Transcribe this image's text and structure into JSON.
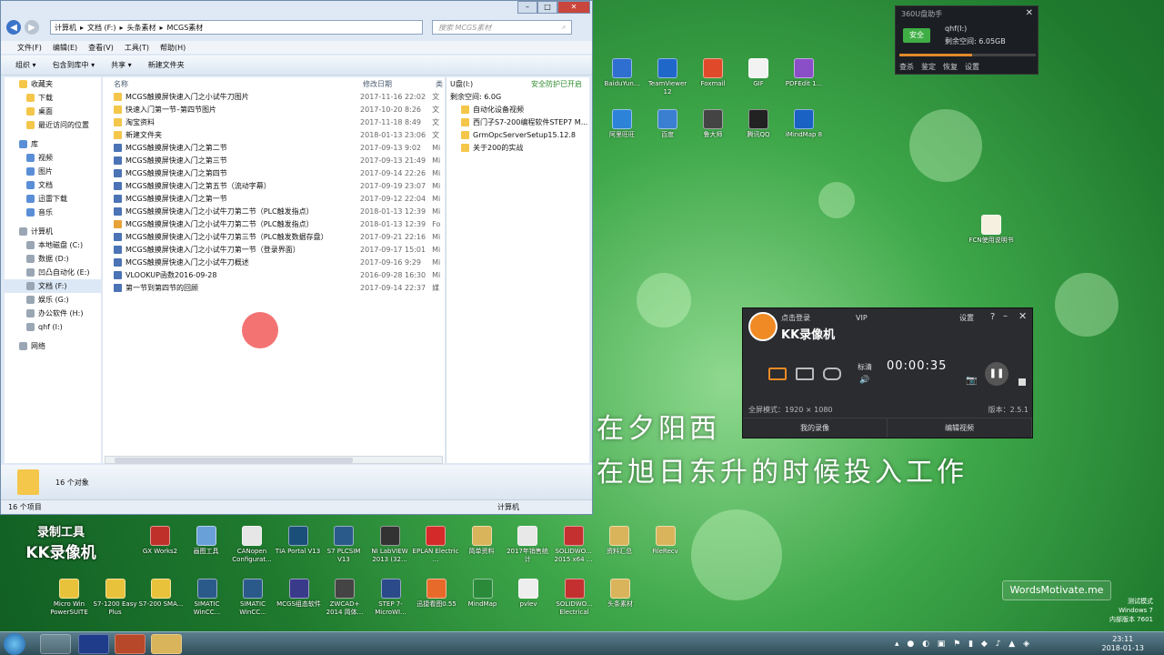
{
  "explorer": {
    "breadcrumb": [
      "计算机",
      "文档 (F:)",
      "头条素材",
      "MCGS素材"
    ],
    "search_placeholder": "搜索 MCGS素材",
    "menu": [
      "文件(F)",
      "编辑(E)",
      "查看(V)",
      "工具(T)",
      "帮助(H)"
    ],
    "toolbar": [
      "组织 ▾",
      "包含到库中 ▾",
      "共享 ▾",
      "新建文件夹"
    ],
    "nav": [
      {
        "label": "收藏夹",
        "sub": false
      },
      {
        "label": "下载",
        "sub": true
      },
      {
        "label": "桌面",
        "sub": true
      },
      {
        "label": "最近访问的位置",
        "sub": true
      },
      {
        "label": "库",
        "sub": false
      },
      {
        "label": "视频",
        "sub": true
      },
      {
        "label": "图片",
        "sub": true
      },
      {
        "label": "文档",
        "sub": true
      },
      {
        "label": "迅雷下载",
        "sub": true
      },
      {
        "label": "音乐",
        "sub": true
      },
      {
        "label": "计算机",
        "sub": false
      },
      {
        "label": "本地磁盘 (C:)",
        "sub": true
      },
      {
        "label": "数据 (D:)",
        "sub": true
      },
      {
        "label": "凹凸自动化 (E:)",
        "sub": true
      },
      {
        "label": "文档 (F:)",
        "sub": true
      },
      {
        "label": "娱乐 (G:)",
        "sub": true
      },
      {
        "label": "办公软件 (H:)",
        "sub": true
      },
      {
        "label": "qhf (I:)",
        "sub": true
      },
      {
        "label": "网络",
        "sub": false
      }
    ],
    "columns": [
      "名称",
      "修改日期",
      "类"
    ],
    "files": [
      {
        "name": "MCGS触摸屏快速入门之小试牛刀图片",
        "date": "2017-11-16 22:02",
        "type": "文",
        "icon": "folder"
      },
      {
        "name": "快速入门第一节–第四节图片",
        "date": "2017-10-20 8:26",
        "type": "文",
        "icon": "folder"
      },
      {
        "name": "淘宝资料",
        "date": "2017-11-18 8:49",
        "type": "文",
        "icon": "folder"
      },
      {
        "name": "新建文件夹",
        "date": "2018-01-13 23:06",
        "type": "文",
        "icon": "folder"
      },
      {
        "name": "MCGS触摸屏快速入门之第二节",
        "date": "2017-09-13 9:02",
        "type": "Mi",
        "icon": "doc"
      },
      {
        "name": "MCGS触摸屏快速入门之第三节",
        "date": "2017-09-13 21:49",
        "type": "Mi",
        "icon": "doc"
      },
      {
        "name": "MCGS触摸屏快速入门之第四节",
        "date": "2017-09-14 22:26",
        "type": "Mi",
        "icon": "doc"
      },
      {
        "name": "MCGS触摸屏快速入门之第五节（流动字幕）",
        "date": "2017-09-19 23:07",
        "type": "Mi",
        "icon": "doc"
      },
      {
        "name": "MCGS触摸屏快速入门之第一节",
        "date": "2017-09-12 22:04",
        "type": "Mi",
        "icon": "doc"
      },
      {
        "name": "MCGS触摸屏快速入门之小试牛刀第二节（PLC触发指点）",
        "date": "2018-01-13 12:39",
        "type": "Mi",
        "icon": "doc"
      },
      {
        "name": "MCGS触摸屏快速入门之小试牛刀第二节（PLC触发指点）",
        "date": "2018-01-13 12:39",
        "type": "Fo",
        "icon": "pdf"
      },
      {
        "name": "MCGS触摸屏快速入门之小试牛刀第三节（PLC触发数据存盘）",
        "date": "2017-09-21 22:16",
        "type": "Mi",
        "icon": "doc"
      },
      {
        "name": "MCGS触摸屏快速入门之小试牛刀第一节（登录界面）",
        "date": "2017-09-17 15:01",
        "type": "Mi",
        "icon": "doc"
      },
      {
        "name": "MCGS触摸屏快速入门之小试牛刀概述",
        "date": "2017-09-16 9:29",
        "type": "Mi",
        "icon": "doc"
      },
      {
        "name": "VLOOKUP函数2016-09-28",
        "date": "2016-09-28 16:30",
        "type": "Mi",
        "icon": "doc"
      },
      {
        "name": "第一节到第四节的回顾",
        "date": "2017-09-14 22:37",
        "type": "媒",
        "icon": "doc"
      }
    ],
    "preview": {
      "drive": "U盘(I:)",
      "autoplay": "安全防护已开启",
      "free": "剩余空间: 6.0G",
      "items": [
        "自动化设备视频",
        "西门子S7-200编程软件STEP7 M...",
        "GrmOpcServerSetup15.12.8",
        "关于200的实战"
      ]
    },
    "count_label": "16 个对象",
    "status_left": "16 个项目",
    "status_right": "计算机"
  },
  "w360": {
    "title": "360U盘助手",
    "safe": "安全",
    "drive": "qhf(I:)",
    "free": "剩余空间: 6.05GB",
    "actions": [
      "查杀",
      "鉴定",
      "恢复",
      "设置"
    ]
  },
  "desktop_right": [
    {
      "label": "BaiduYun...",
      "x": 0
    },
    {
      "label": "TeamViewer 12",
      "x": 1
    },
    {
      "label": "Foxmail",
      "x": 2
    },
    {
      "label": "GIF",
      "x": 3
    },
    {
      "label": "PDFEdit 1...",
      "x": 4
    },
    {
      "label": "阿里旺旺",
      "x": 0
    },
    {
      "label": "百度",
      "x": 1
    },
    {
      "label": "鲁大师",
      "x": 2
    },
    {
      "label": "腾讯QQ",
      "x": 3
    },
    {
      "label": "iMindMap 8",
      "x": 4
    }
  ],
  "fcn_icon": "FCN使用说明书",
  "kk": {
    "login": "点击登录",
    "vip": "VIP",
    "title": "KK录像机",
    "settings": "设置",
    "help": "?",
    "quality": "标清",
    "time": "00:00:35",
    "fullscreen": "全屏模式：1920 × 1080",
    "version": "版本：2.5.1",
    "my_video": "我的录像",
    "edit_video": "编辑视频"
  },
  "subtitle1": "在夕阳西",
  "subtitle2": "在旭日东升的时候投入工作",
  "watermark": "WordsMotivate.me",
  "win7": [
    "测试模式",
    "Windows 7",
    "内部版本 7601"
  ],
  "kk_logo": [
    "录制工具",
    "KK录像机"
  ],
  "desktop_bottom1": [
    "GX Works2",
    "画图工具",
    "CANopen Configurat...",
    "TIA Portal V13",
    "S7 PLCSIM V13",
    "NI LabVIEW 2013 (32...",
    "EPLAN Electric ...",
    "简单资料",
    "2017年销售统计",
    "SOLIDWO... 2015 x64 ...",
    "资料汇总",
    "FileRecv"
  ],
  "desktop_bottom2": [
    "Micro Win PowerSUITE",
    "S7-1200 Easy Plus",
    "S7-200 SMA...",
    "SIMATIC WinCC...",
    "SIMATIC WinCC...",
    "MCGS组态软件",
    "ZWCAD+ 2014 简体...",
    "STEP 7-MicroWI...",
    "迅捷看图0.55",
    "MindMap",
    "pvlev",
    "SOLIDWO... Electrical",
    "头条素材"
  ],
  "clock": {
    "time": "23:11",
    "date": "2018-01-13"
  }
}
